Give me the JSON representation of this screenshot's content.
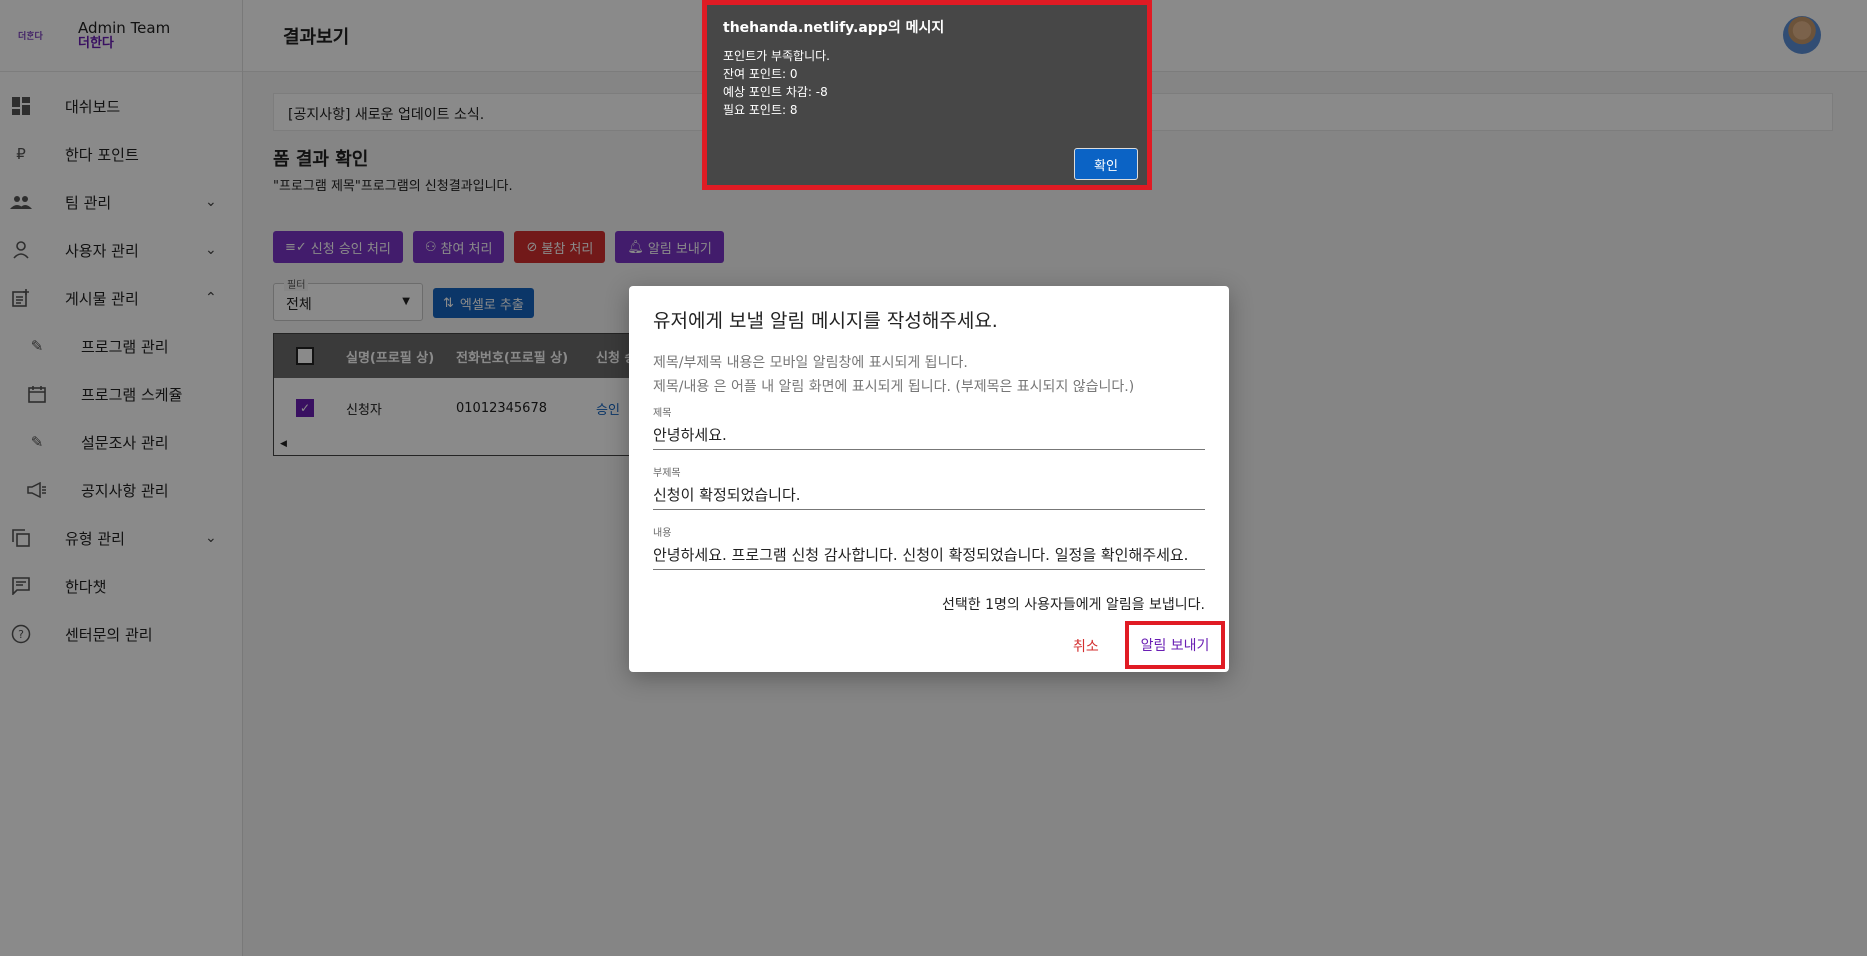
{
  "brand": {
    "logo_text": "더ᄒᆞᆫ다",
    "title": "Admin Team",
    "subtitle": "더한다"
  },
  "sidebar": {
    "items": [
      {
        "label": "대쉬보드",
        "icon": "dashboard-icon"
      },
      {
        "label": "한다 포인트",
        "icon": "ruble-icon"
      },
      {
        "label": "팀 관리",
        "icon": "people-icon",
        "expand": "chevron-down"
      },
      {
        "label": "사용자 관리",
        "icon": "person-icon",
        "expand": "chevron-down"
      },
      {
        "label": "게시물 관리",
        "icon": "post-add-icon",
        "expand": "chevron-up"
      },
      {
        "label": "프로그램 관리",
        "icon": "pencil-icon",
        "sub": true
      },
      {
        "label": "프로그램 스케쥴",
        "icon": "calendar-icon",
        "sub": true
      },
      {
        "label": "설문조사 관리",
        "icon": "pencil-icon",
        "sub": true
      },
      {
        "label": "공지사항 관리",
        "icon": "megaphone-icon",
        "sub": true
      },
      {
        "label": "유형 관리",
        "icon": "copy-icon",
        "expand": "chevron-down"
      },
      {
        "label": "한다챗",
        "icon": "chat-icon"
      },
      {
        "label": "센터문의 관리",
        "icon": "help-icon"
      }
    ]
  },
  "header": {
    "title": "결과보기"
  },
  "notice": {
    "text": "[공지사항] 새로운 업데이트 소식."
  },
  "form": {
    "title": "폼 결과 확인",
    "subtitle": "\"프로그램 제목\"프로그램의 신청결과입니다."
  },
  "actions": {
    "approve": "신청 승인 처리",
    "participate": "참여 처리",
    "absent": "불참 처리",
    "notify": "알림 보내기"
  },
  "filter": {
    "label": "필터",
    "value": "전체"
  },
  "excel_label": "엑셀로 추출",
  "table": {
    "headers": [
      "실명(프로필 상)",
      "전화번호(프로필 상)",
      "신청 승"
    ],
    "rows": [
      {
        "name": "신청자",
        "phone": "01012345678",
        "status": "승인",
        "checked": true
      }
    ]
  },
  "dialog": {
    "title": "유저에게 보낼 알림 메시지를 작성해주세요.",
    "help1": "제목/부제목 내용은 모바일 알림창에 표시되게 됩니다.",
    "help2": "제목/내용 은 어플 내 알림 화면에 표시되게 됩니다. (부제목은 표시되지 않습니다.)",
    "title_label": "제목",
    "title_value": "안녕하세요.",
    "subtitle_label": "부제목",
    "subtitle_value": "신청이 확정되었습니다.",
    "content_label": "내용",
    "content_value": "안녕하세요. 프로그램 신청 감사합니다. 신청이 확정되었습니다. 일정을 확인해주세요.",
    "count_text": "선택한 1명의 사용자들에게 알림을 보냅니다.",
    "cancel": "취소",
    "send": "알림 보내기"
  },
  "alert": {
    "title": "thehanda.netlify.app의 메시지",
    "line1": "포인트가 부족합니다.",
    "line2": "잔여 포인트: 0",
    "line3": "예상 포인트 차감: -8",
    "line4": "필요 포인트: 8",
    "ok": "확인"
  },
  "colors": {
    "accent": "#7b35c7",
    "danger": "#d32f2f",
    "primary": "#1565c0",
    "highlight": "#e01b24"
  }
}
